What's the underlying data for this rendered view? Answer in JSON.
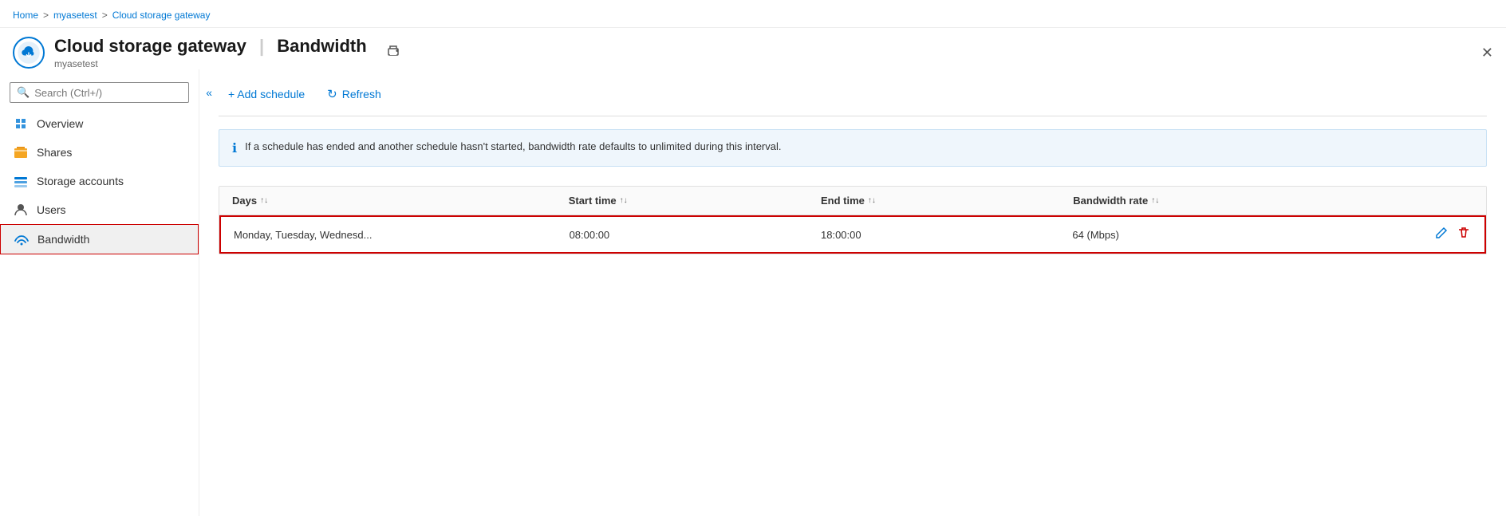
{
  "breadcrumb": {
    "home": "Home",
    "sep1": ">",
    "myasetest": "myasetest",
    "sep2": ">",
    "current": "Cloud storage gateway"
  },
  "header": {
    "title": "Cloud storage gateway",
    "separator": "|",
    "subtitle": "Bandwidth",
    "subtitle_text": "myasetest"
  },
  "search": {
    "placeholder": "Search (Ctrl+/)"
  },
  "collapse_label": "«",
  "nav": {
    "items": [
      {
        "id": "overview",
        "label": "Overview",
        "icon": "cloud"
      },
      {
        "id": "shares",
        "label": "Shares",
        "icon": "folder"
      },
      {
        "id": "storage-accounts",
        "label": "Storage accounts",
        "icon": "storage"
      },
      {
        "id": "users",
        "label": "Users",
        "icon": "user"
      },
      {
        "id": "bandwidth",
        "label": "Bandwidth",
        "icon": "wifi",
        "active": true
      }
    ]
  },
  "toolbar": {
    "add_label": "+ Add schedule",
    "refresh_label": "Refresh"
  },
  "info_banner": {
    "text": "If a schedule has ended and another schedule hasn't started, bandwidth rate defaults to unlimited during this interval."
  },
  "table": {
    "columns": [
      {
        "label": "Days",
        "sort": "↑↓"
      },
      {
        "label": "Start time",
        "sort": "↑↓"
      },
      {
        "label": "End time",
        "sort": "↑↓"
      },
      {
        "label": "Bandwidth rate",
        "sort": "↑↓"
      }
    ],
    "rows": [
      {
        "days": "Monday, Tuesday, Wednesd...",
        "start_time": "08:00:00",
        "end_time": "18:00:00",
        "bandwidth_rate": "64 (Mbps)"
      }
    ]
  }
}
